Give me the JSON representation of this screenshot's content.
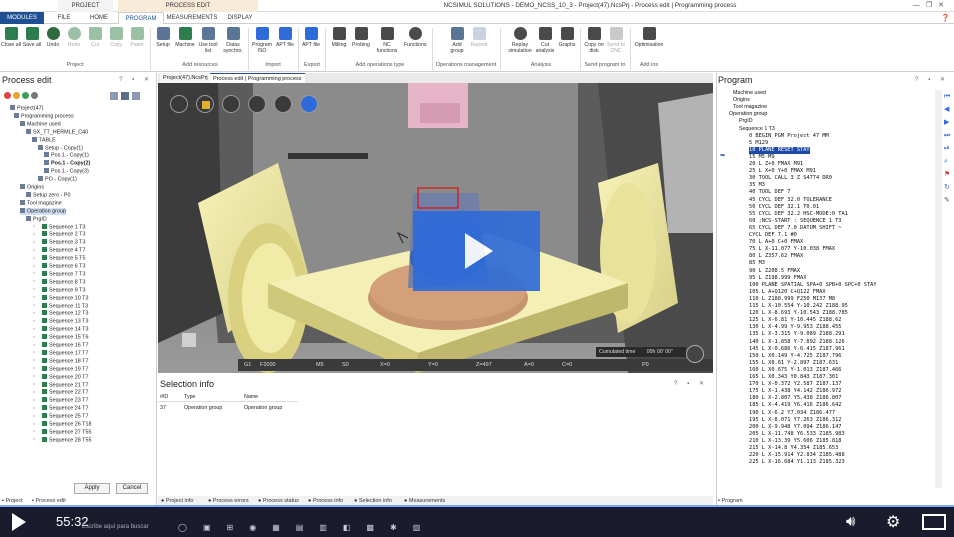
{
  "titlebar": {
    "ctx_project": "PROJECT",
    "ctx_process_edit": "PROCESS EDIT",
    "title": "NCSIMUL SOLUTIONS - DEMO_NCSS_10_3 - Project(47).NcsPrj - Process edit | Programming process"
  },
  "tabs": [
    "MODULES",
    "FILE",
    "HOME",
    "PROGRAM",
    "MEASUREMENTS",
    "DISPLAY"
  ],
  "ribbon": {
    "buttons": [
      "Close all",
      "Save all",
      "Undo",
      "Redo",
      "Cut",
      "Copy",
      "Paste",
      "Setup",
      "Machine",
      "Use tool list",
      "Datas synchro.",
      "Program ISO",
      "APT file",
      "APT file",
      "Milling",
      "Probing",
      "NC functions",
      "Functions",
      "Add group",
      "Repeat",
      "Replay simulation",
      "Cut analysis",
      "Graphs",
      "Copy on disk",
      "Send to DNC",
      "Optimisation"
    ],
    "groups": [
      "Project",
      "Add resources",
      "Import",
      "Export",
      "Add operations type",
      "Operations management",
      "Analysis",
      "Send program to",
      "Add ins"
    ]
  },
  "left_panel": {
    "title": "Process edit",
    "tree": [
      "Project(47)",
      "Programming process",
      "Machine used",
      "SX_TT_HERMLE_C40",
      "TABLE",
      "Setup - Copy(1)",
      "Pos.1 - Copy(1)",
      "Pos.1 - Copy(2)",
      "Pos.1 - Copy(3)",
      "PO - Copy(1)",
      "Origins",
      "Setup zero - P0",
      "Tool magazine",
      "Operation group",
      "PrgID",
      "Sequence 1 T3",
      "Sequence 2 T3",
      "Sequence 3 T3",
      "Sequence 4 T7",
      "Sequence 5 T5",
      "Sequence 6 T3",
      "Sequence 7 T3",
      "Sequence 8 T3",
      "Sequence 9 T3",
      "Sequence 10 T3",
      "Sequence 11 T3",
      "Sequence 12 T3",
      "Sequence 13 T3",
      "Sequence 14 T3",
      "Sequence 15 T6",
      "Sequence 16 T7",
      "Sequence 17 T7",
      "Sequence 18 T7",
      "Sequence 19 T7",
      "Sequence 20 T7",
      "Sequence 21 T7",
      "Sequence 22 T7",
      "Sequence 23 T7",
      "Sequence 24 T7",
      "Sequence 25 T7",
      "Sequence 26 T18",
      "Sequence 27 T55",
      "Sequence 28 T55"
    ],
    "apply": "Apply",
    "cancel": "Cancel",
    "bottom_tabs": [
      "Project",
      "Process edit"
    ]
  },
  "viewport": {
    "tabs": [
      "Project(47).NcsPrj",
      "Process edit | Programming process"
    ],
    "status": {
      "g": "G1",
      "f": "F2000",
      "m": "M5",
      "s": "S0",
      "x": "X=0",
      "y": "Y=0",
      "z": "Z=497",
      "a": "A=0",
      "c": "C=0",
      "cumul_label": "Cumulated time",
      "cumul_value": "00h 00' 00\"",
      "p": "P0"
    }
  },
  "selection_info": {
    "title": "Selection info",
    "columns": [
      "#ID",
      "Type",
      "Name"
    ],
    "rows": [
      [
        "37",
        "Operation group",
        "Operation group"
      ]
    ],
    "bottom_tabs": [
      "Project info",
      "Process errors",
      "Process status",
      "Process info",
      "Selection info",
      "Measurements"
    ]
  },
  "program": {
    "title": "Program",
    "header_lines": [
      "Machine used",
      "Origins",
      "Tool magazine",
      "Operation group",
      "PrgID",
      "Sequence 1 T3"
    ],
    "lines": [
      "0 BEGIN PGM Project 47  MM",
      "5 M129",
      "10 PLANE RESET STAY",
      "15 M5 M9",
      "20 L Z+0 FMAX M91",
      "25 L X+0 Y+0 FMAX M91",
      "30 TOOL CALL 3 Z S4774 DR0",
      "35 M3",
      "40 TOOL DEF 7",
      "45 CYCL DEF 32.0 TOLERANCE",
      "50 CYCL DEF 32.1 T0.01",
      "55 CYCL DEF 32.2 HSC-MODE:0 TA1",
      "60 ;NCS-START : SEQUENCE 1 T3",
      "65 CYCL DEF 7.0 DATUM SHIFT ~",
      "CYCL DEF 7.1 #0",
      "70 L A+0 C+0 FMAX",
      "75 L X-11.077 Y-10.038 FMAX",
      "80 L Z357.62 FMAX",
      "85 M3",
      "90 L Z208.5 FMAX",
      "95 L Z198.999 FMAX",
      "100 PLANE SPATIAL SPA+0 SPB+0 SPC+0 STAY",
      "105 L A+Q120 C+Q122 FMAX",
      "110 L Z188.999 F250 M137 M8",
      "115 L X-10.554 Y-10.242 Z188.95",
      "120 L X-8.693 Y-10.543 Z188.785",
      "125 L X-6.81 Y-10.445 Z188.62",
      "130 L X-4.99 Y-9.953 Z188.455",
      "135 L X-3.315 Y-9.089 Z188.291",
      "140 L X-1.858 Y-7.892 Z188.126",
      "145 L X-0.686 Y-6.415 Z187.961",
      "150 L X0.149 Y-4.725 Z187.796",
      "155 L X0.61 Y-2.897 Z187.631",
      "160 L X0.675 Y-1.013 Z187.466",
      "165 L X0.343 Y0.843 Z187.301",
      "170 L X-0.372 Y2.587 Z187.137",
      "175 L X-1.438 Y4.142 Z186.972",
      "180 L X-2.807 Y5.438 Z186.807",
      "185 L X-4.419 Y6.416 Z186.642",
      "190 L X-6.2 Y7.034 Z186.477",
      "195 L X-8.071 Y7.263 Z186.312",
      "200 L X-9.948 Y7.094 Z186.147",
      "205 L X-11.748 Y6.533 Z185.983",
      "210 L X-13.39 Y5.606 Z185.818",
      "215 L X-14.8 Y4.354 Z185.653",
      "220 L X-15.914 Y2.834 Z185.488",
      "225 L X-16.684 Y1.113 Z185.323"
    ],
    "highlight_index": 2,
    "bottom_tab": "Program"
  },
  "player": {
    "time": "55:32",
    "search_placeholder": "Escribe aquí para buscar"
  },
  "colors": {
    "accent": "#1d4f91",
    "play": "#2f6bd8",
    "highlight": "#1f4aa8",
    "machine_yellow": "#f1eba8",
    "part_copper": "#d4a07a",
    "spindle_blue": "#3b5fb5"
  }
}
